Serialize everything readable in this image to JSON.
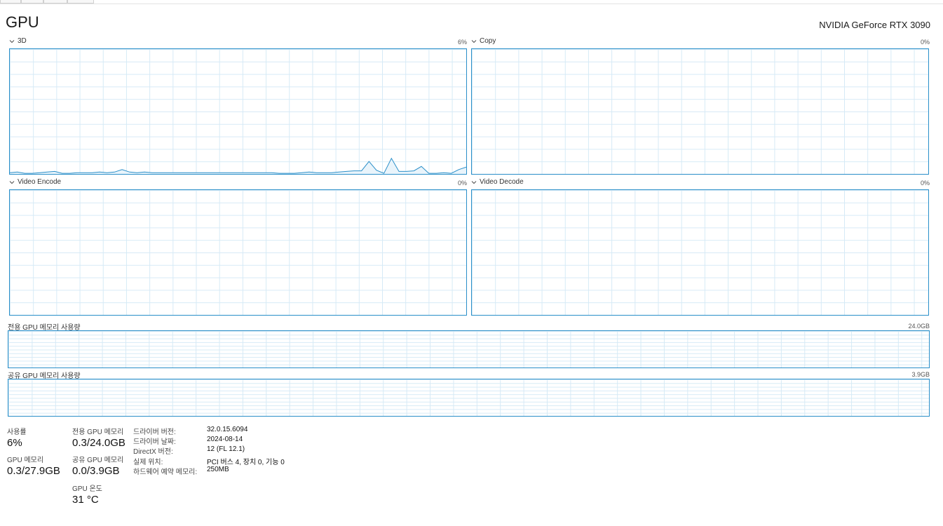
{
  "header": {
    "title": "GPU",
    "gpu_name": "NVIDIA GeForce RTX 3090"
  },
  "engines": [
    {
      "label": "3D",
      "value": "6%"
    },
    {
      "label": "Copy",
      "value": "0%"
    },
    {
      "label": "Video Encode",
      "value": "0%"
    },
    {
      "label": "Video Decode",
      "value": "0%"
    }
  ],
  "memory_graphs": [
    {
      "label": "전용 GPU 메모리 사용량",
      "value": "24.0GB"
    },
    {
      "label": "공유 GPU 메모리 사용량",
      "value": "3.9GB"
    }
  ],
  "stats": {
    "utilization": {
      "label": "사용률",
      "value": "6%"
    },
    "gpu_memory": {
      "label": "GPU 메모리",
      "value": "0.3/27.9GB"
    },
    "dedicated_memory": {
      "label": "전용 GPU 메모리",
      "value": "0.3/24.0GB"
    },
    "shared_memory": {
      "label": "공유 GPU 메모리",
      "value": "0.0/3.9GB"
    },
    "temperature": {
      "label": "GPU 온도",
      "value": "31 °C"
    }
  },
  "info": [
    {
      "key": "드라이버 버전:",
      "value": "32.0.15.6094"
    },
    {
      "key": "드라이버 날짜:",
      "value": "2024-08-14"
    },
    {
      "key": "DirectX 버전:",
      "value": "12 (FL 12.1)"
    },
    {
      "key": "실제 위치:",
      "value": "PCI 버스 4, 장치 0, 기능 0"
    },
    {
      "key": "하드웨어 예약 메모리:",
      "value": "250MB"
    }
  ],
  "chart_data": {
    "type": "line",
    "series": [
      {
        "name": "3D",
        "values": [
          1,
          1.5,
          0.5,
          0.5,
          1,
          1.5,
          2,
          0.5,
          0.5,
          1,
          1,
          1,
          1.5,
          1,
          1.5,
          3.5,
          1.5,
          1,
          1.5,
          1,
          1,
          1,
          1,
          1,
          1,
          1,
          1,
          1,
          1,
          1,
          1,
          1,
          1,
          1,
          1,
          1,
          0.5,
          0.5,
          0.5,
          1,
          1.5,
          1,
          1,
          1,
          1.5,
          2,
          2.5,
          2.5,
          10,
          3,
          0.5,
          12.5,
          2,
          2,
          2.5,
          6,
          0.5,
          0.5,
          1,
          0.5,
          3.5,
          5.5
        ]
      },
      {
        "name": "Copy",
        "values": []
      },
      {
        "name": "Video Encode",
        "values": []
      },
      {
        "name": "Video Decode",
        "values": []
      }
    ],
    "ylim": [
      0,
      100
    ]
  },
  "colors": {
    "accent": "#2a8fc9",
    "grid": "#d6eaf6"
  },
  "icons": {
    "expand": "chevron-down-icon"
  }
}
